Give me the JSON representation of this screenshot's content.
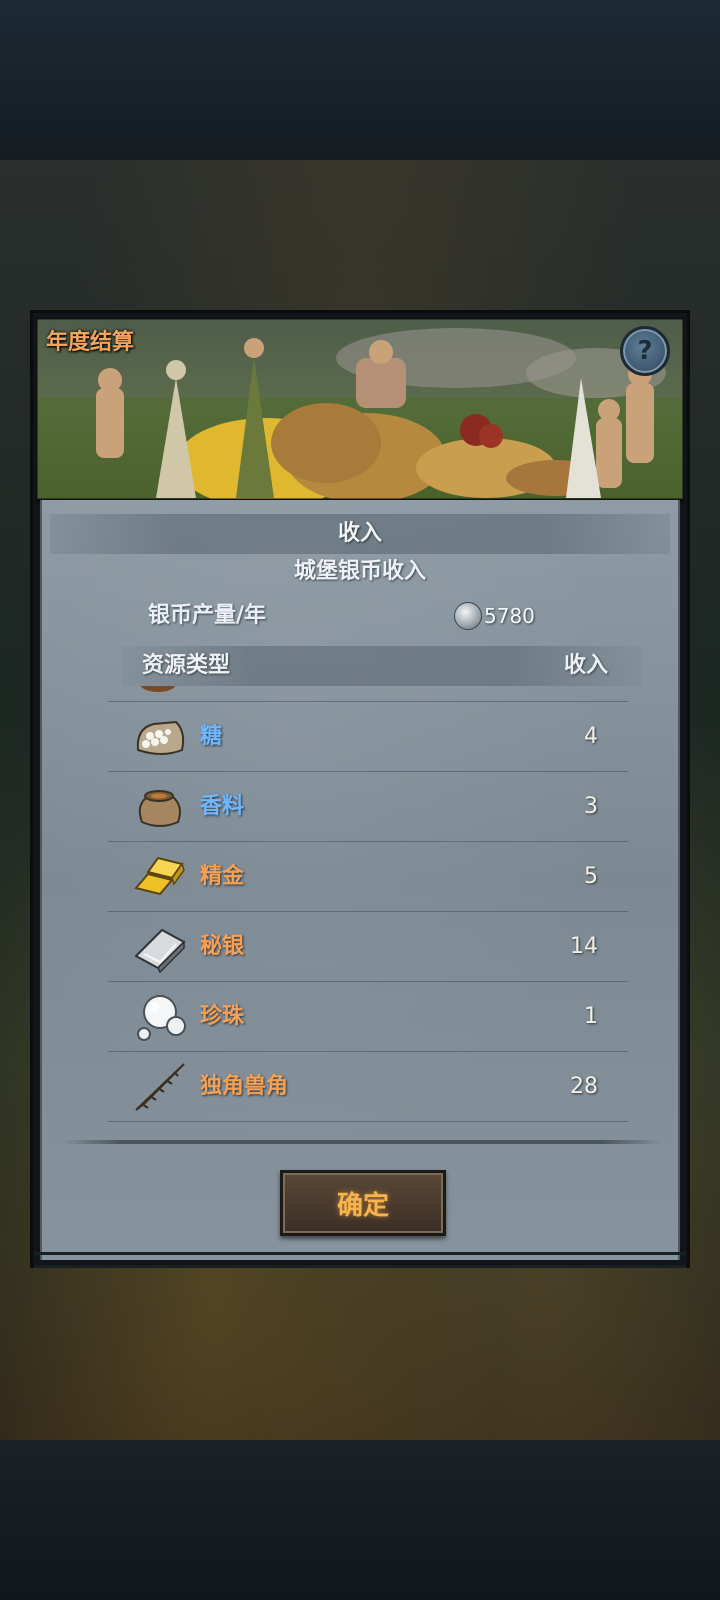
{
  "header": {
    "title": "年度结算",
    "help_label": "?"
  },
  "income": {
    "section_title": "收入",
    "subtitle": "城堡银币收入",
    "production_label": "银币产量/年",
    "production_value": "5780"
  },
  "table": {
    "col_type": "资源类型",
    "col_income": "收入",
    "rows": [
      {
        "name": "糖",
        "value": "4",
        "icon": "sugar-sack-icon",
        "color": "#6fb8ff"
      },
      {
        "name": "香料",
        "value": "3",
        "icon": "spice-bag-icon",
        "color": "#6fb8ff"
      },
      {
        "name": "精金",
        "value": "5",
        "icon": "gold-ingot-icon",
        "color": "#f6a056"
      },
      {
        "name": "秘银",
        "value": "14",
        "icon": "mithril-ingot-icon",
        "color": "#f6a056"
      },
      {
        "name": "珍珠",
        "value": "1",
        "icon": "pearl-icon",
        "color": "#f6a056"
      },
      {
        "name": "独角兽角",
        "value": "28",
        "icon": "unicorn-horn-icon",
        "color": "#f6a056"
      }
    ]
  },
  "confirm_label": "确定"
}
